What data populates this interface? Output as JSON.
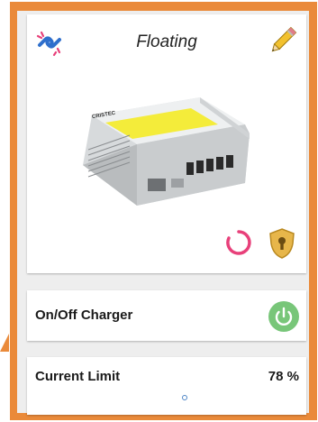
{
  "status": {
    "title": "Floating"
  },
  "device": {
    "brand_label": "CRISTEC"
  },
  "on_off": {
    "label": "On/Off Charger"
  },
  "current_limit": {
    "label": "Current Limit",
    "value": "78 %",
    "level_fraction": 0.78
  },
  "icons": [
    "link-broken-icon",
    "pencil-icon",
    "loading-spinner-icon",
    "shield-keyhole-icon",
    "power-icon"
  ],
  "colors": {
    "frame": "#ea8a3a",
    "spinner": "#e8407a",
    "power": "#78c679",
    "shield": "#e7b64a",
    "link": "#2f6fcc"
  }
}
